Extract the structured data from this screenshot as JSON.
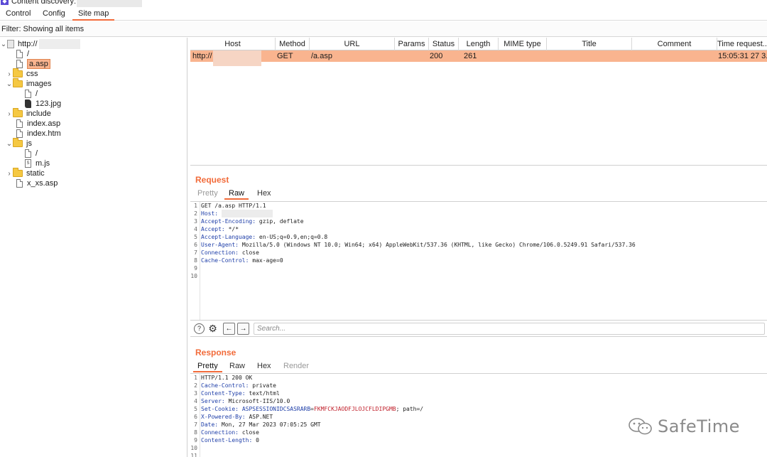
{
  "window": {
    "title": "Content discovery:"
  },
  "tabs": [
    {
      "label": "Control"
    },
    {
      "label": "Config"
    },
    {
      "label": "Site map"
    }
  ],
  "filter": {
    "text": "Filter: Showing all items"
  },
  "tree": {
    "items": [
      {
        "label": "http://",
        "icon": "host-icon",
        "expand": "collapse"
      },
      {
        "label": "/",
        "icon": "file-icon"
      },
      {
        "label": "a.asp",
        "icon": "file-icon",
        "selected": true
      },
      {
        "label": "css",
        "icon": "folder-icon",
        "expand": "expand"
      },
      {
        "label": "images",
        "icon": "folder-icon",
        "expand": "collapse"
      },
      {
        "label": "/",
        "icon": "file-icon"
      },
      {
        "label": "123.jpg",
        "icon": "image-file-icon"
      },
      {
        "label": "include",
        "icon": "folder-icon",
        "expand": "expand"
      },
      {
        "label": "index.asp",
        "icon": "file-icon"
      },
      {
        "label": "index.htm",
        "icon": "file-icon"
      },
      {
        "label": "js",
        "icon": "folder-icon",
        "expand": "collapse"
      },
      {
        "label": "/",
        "icon": "file-icon"
      },
      {
        "label": "m.js",
        "icon": "js-file-icon"
      },
      {
        "label": "static",
        "icon": "folder-icon",
        "expand": "expand"
      },
      {
        "label": "x_xs.asp",
        "icon": "file-icon"
      }
    ]
  },
  "table": {
    "columns": [
      "Host",
      "Method",
      "URL",
      "Params",
      "Status",
      "Length",
      "MIME type",
      "Title",
      "Comment",
      "Time request..."
    ],
    "rows": [
      {
        "host": "http://",
        "method": "GET",
        "url": "/a.asp",
        "params": "",
        "status": "200",
        "length": "261",
        "mime": "",
        "title": "",
        "comment": "",
        "time": "15:05:31 27 3..."
      }
    ]
  },
  "request": {
    "title": "Request",
    "tabs": [
      "Pretty",
      "Raw",
      "Hex"
    ],
    "lines": [
      {
        "n": "1",
        "key": "",
        "val": "GET /a.asp HTTP/1.1"
      },
      {
        "n": "2",
        "key": "Host",
        "val": ""
      },
      {
        "n": "3",
        "key": "Accept-Encoding",
        "val": "gzip, deflate"
      },
      {
        "n": "4",
        "key": "Accept",
        "val": "*/*"
      },
      {
        "n": "5",
        "key": "Accept-Language",
        "val": "en-US;q=0.9,en;q=0.8"
      },
      {
        "n": "6",
        "key": "User-Agent",
        "val": "Mozilla/5.0 (Windows NT 10.0; Win64; x64) AppleWebKit/537.36 (KHTML, like Gecko) Chrome/106.0.5249.91 Safari/537.36"
      },
      {
        "n": "7",
        "key": "Connection",
        "val": "close"
      },
      {
        "n": "8",
        "key": "Cache-Control",
        "val": "max-age=0"
      },
      {
        "n": "9",
        "key": "",
        "val": ""
      },
      {
        "n": "10",
        "key": "",
        "val": ""
      }
    ]
  },
  "search": {
    "placeholder": "Search..."
  },
  "response": {
    "title": "Response",
    "tabs": [
      "Pretty",
      "Raw",
      "Hex",
      "Render"
    ],
    "lines": [
      {
        "n": "1",
        "key": "",
        "val": "HTTP/1.1 200 OK"
      },
      {
        "n": "2",
        "key": "Cache-Control",
        "val": "private"
      },
      {
        "n": "3",
        "key": "Content-Type",
        "val": "text/html"
      },
      {
        "n": "4",
        "key": "Server",
        "val": "Microsoft-IIS/10.0"
      },
      {
        "n": "5",
        "key": "Set-Cookie",
        "val": "",
        "cookie_name": "ASPSESSIONIDCSASRARB",
        "cookie_val": "FKMFCKJAODFJLOJCFLDIPGMB",
        "cookie_rest": "; path=/"
      },
      {
        "n": "6",
        "key": "X-Powered-By",
        "val": "ASP.NET"
      },
      {
        "n": "7",
        "key": "Date",
        "val": "Mon, 27 Mar 2023 07:05:25 GMT"
      },
      {
        "n": "8",
        "key": "Connection",
        "val": "close"
      },
      {
        "n": "9",
        "key": "Content-Length",
        "val": "0"
      },
      {
        "n": "10",
        "key": "",
        "val": ""
      },
      {
        "n": "11",
        "key": "",
        "val": ""
      }
    ]
  },
  "watermark": {
    "text": "SafeTime"
  },
  "colors": {
    "accent": "#f26b3a",
    "selection": "#f9b48f",
    "header_key": "#1e3ea8",
    "cookie_value": "#c0202b"
  }
}
